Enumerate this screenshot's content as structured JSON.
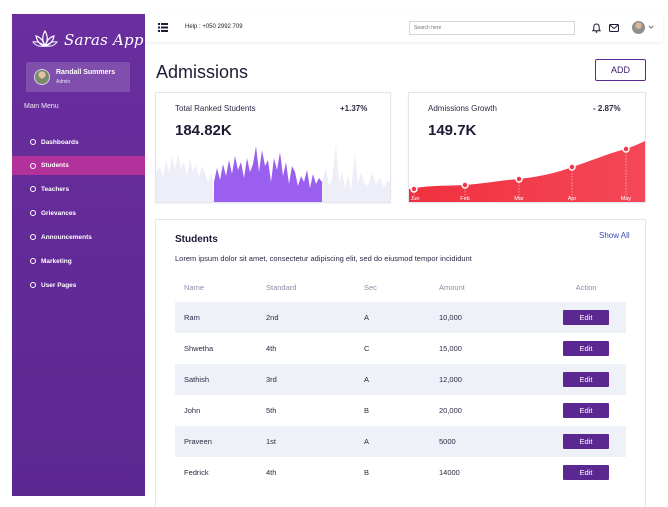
{
  "brand": {
    "name": "Saras App"
  },
  "user": {
    "name": "Randall Summers",
    "role": "Admin"
  },
  "sidebar": {
    "menu_title": "Main Menu",
    "items": [
      {
        "label": "Dashboards"
      },
      {
        "label": "Students",
        "active": true
      },
      {
        "label": "Teachers"
      },
      {
        "label": "Grievances"
      },
      {
        "label": "Announcements"
      },
      {
        "label": "Marketing"
      },
      {
        "label": "User Pages"
      }
    ]
  },
  "topbar": {
    "help": "Help : +050 2992 709",
    "search_placeholder": "Search here",
    "icons": [
      "menu-icon",
      "bell-icon",
      "mail-icon",
      "avatar",
      "chevron-down-icon"
    ]
  },
  "page": {
    "title": "Admissions",
    "add_label": "ADD"
  },
  "stats": [
    {
      "label": "Total Ranked Students",
      "change": "+1.37%",
      "value": "184.82K"
    },
    {
      "label": "Admissions Growth",
      "change": "- 2.87%",
      "value": "149.7K"
    }
  ],
  "growth_chart": {
    "type": "area",
    "categories": [
      "Jun",
      "Feb",
      "Mar",
      "Apr",
      "May"
    ]
  },
  "students": {
    "title": "Students",
    "show_all": "Show All",
    "description": "Lorem ipsum dolor sit amet, consectetur adipiscing elit, sed do eiusmod tempor incididunt",
    "columns": [
      "Name",
      "Standard",
      "Sec",
      "Amount",
      "Action"
    ],
    "rows": [
      {
        "name": "Ram",
        "standard": "2nd",
        "sec": "A",
        "amount": "10,000",
        "action": "Edit"
      },
      {
        "name": "Shwetha",
        "standard": "4th",
        "sec": "C",
        "amount": "15,000",
        "action": "Edit"
      },
      {
        "name": "Sathish",
        "standard": "3rd",
        "sec": "A",
        "amount": "12,000",
        "action": "Edit"
      },
      {
        "name": "John",
        "standard": "5th",
        "sec": "B",
        "amount": "20,000",
        "action": "Edit"
      },
      {
        "name": "Praveen",
        "standard": "1st",
        "sec": "A",
        "amount": "5000",
        "action": "Edit"
      },
      {
        "name": "Fedrick",
        "standard": "4th",
        "sec": "B",
        "amount": "14000",
        "action": "Edit"
      }
    ]
  },
  "colors": {
    "primary": "#5b2791",
    "active": "#b2319b",
    "growth": "#f0384a",
    "bars": "#9b5ff0"
  }
}
